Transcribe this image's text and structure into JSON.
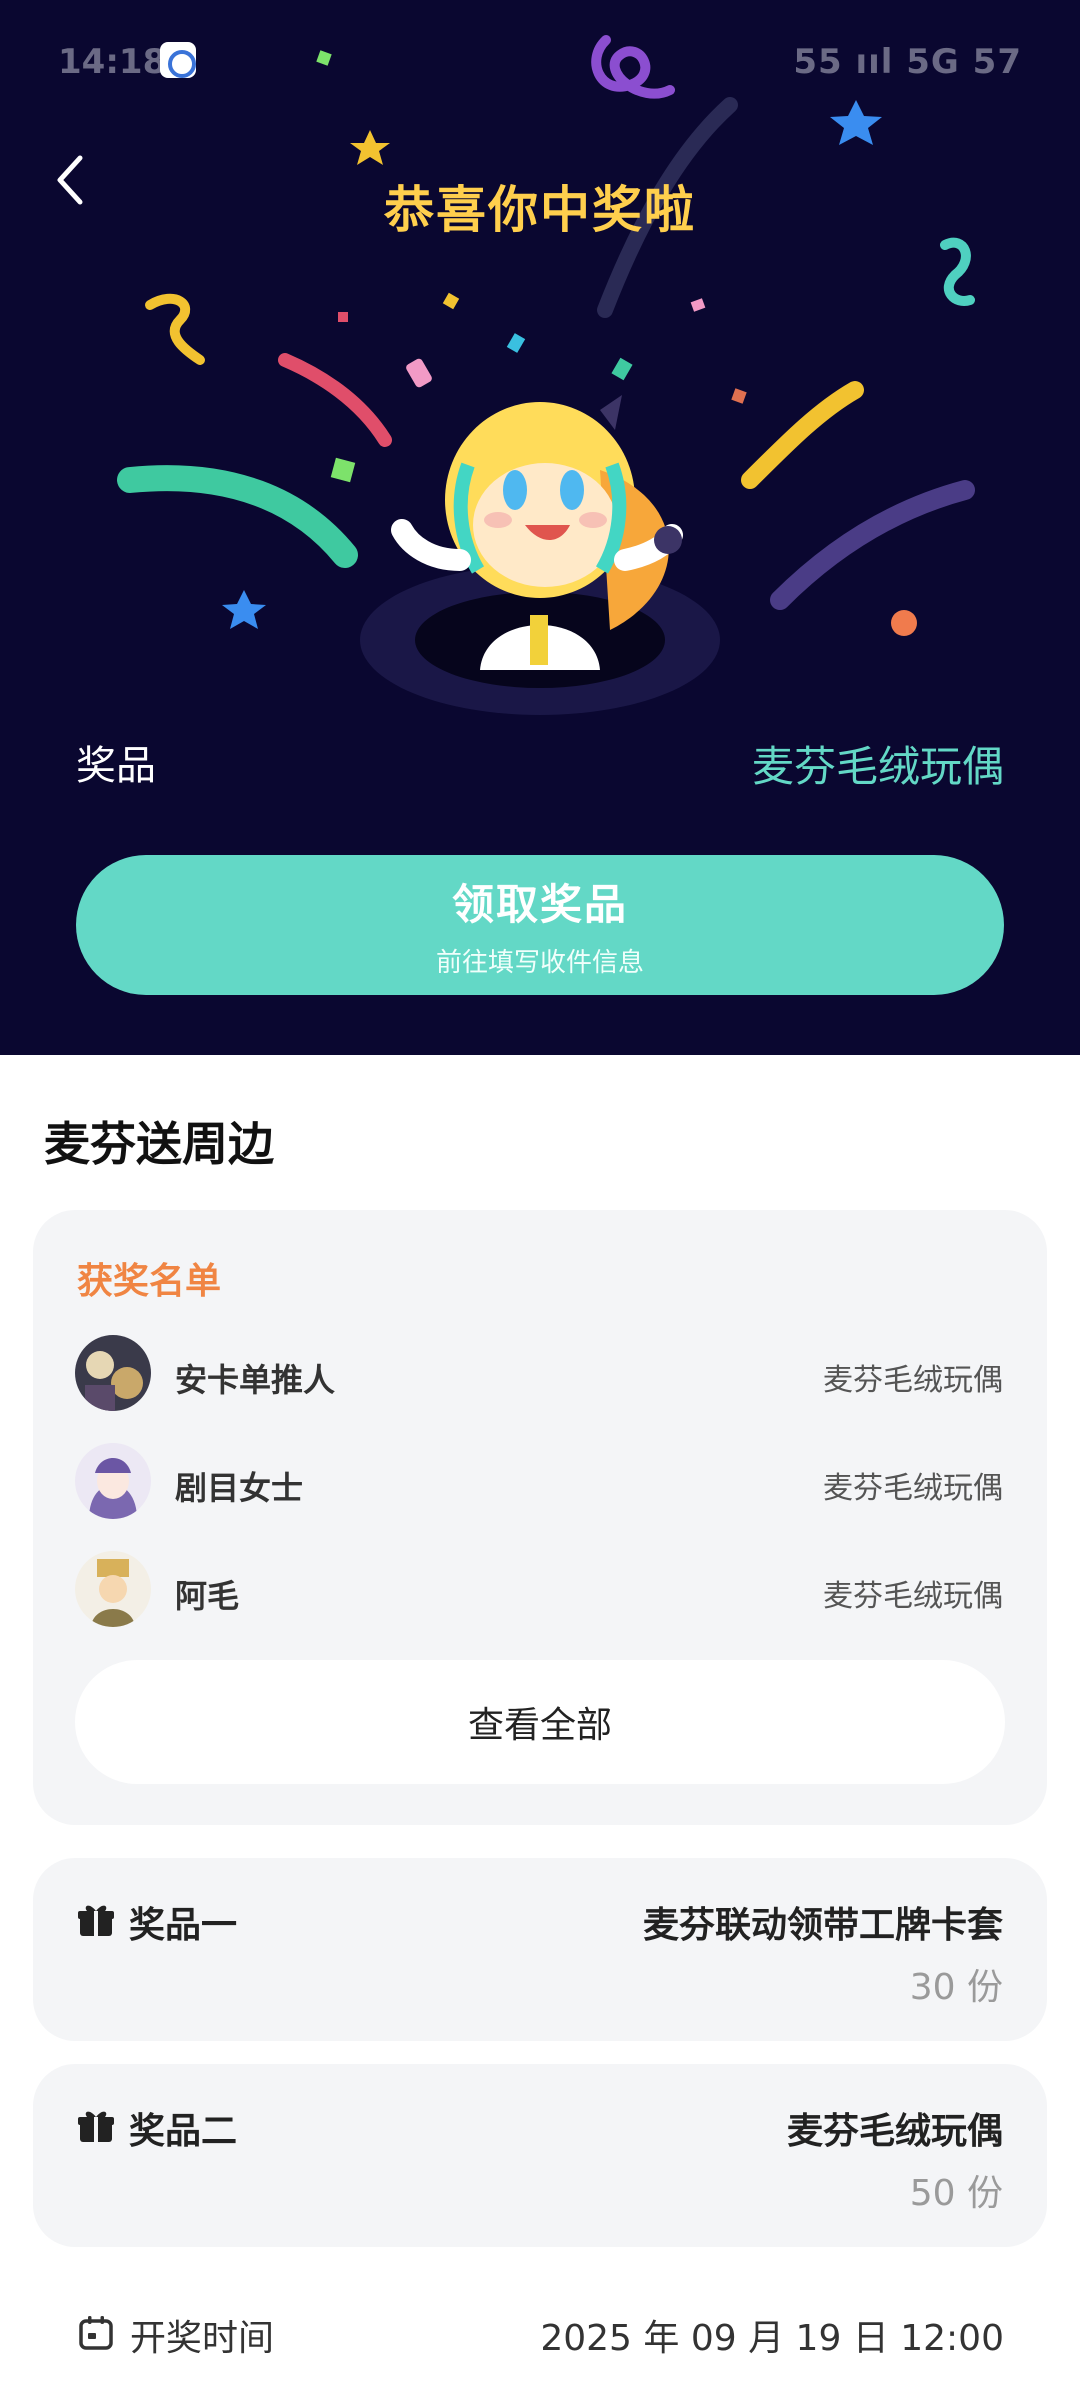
{
  "status_bar": {
    "time": "14:18",
    "right_text": "55 ııl 5G 57"
  },
  "header": {
    "title": "恭喜你中奖啦"
  },
  "prize_summary": {
    "label": "奖品",
    "value": "麦芬毛绒玩偶"
  },
  "claim_button": {
    "label": "领取奖品",
    "sublabel": "前往填写收件信息"
  },
  "section": {
    "title": "麦芬送周边"
  },
  "winners": {
    "title": "获奖名单",
    "items": [
      {
        "name": "安卡单推人",
        "prize": "麦芬毛绒玩偶"
      },
      {
        "name": "剧目女士",
        "prize": "麦芬毛绒玩偶"
      },
      {
        "name": "阿毛",
        "prize": "麦芬毛绒玩偶"
      }
    ],
    "view_all_label": "查看全部"
  },
  "prizes": [
    {
      "label": "奖品一",
      "name": "麦芬联动领带工牌卡套",
      "qty": "30 份"
    },
    {
      "label": "奖品二",
      "name": "麦芬毛绒玩偶",
      "qty": "50 份"
    }
  ],
  "draw_time": {
    "label": "开奖时间",
    "value": "2025 年 09 月 19 日 12:00"
  },
  "colors": {
    "hero_bg": "#0a0730",
    "accent": "#63d8c6",
    "title_gold": "#ffcf4d",
    "winners_title": "#f08543"
  }
}
